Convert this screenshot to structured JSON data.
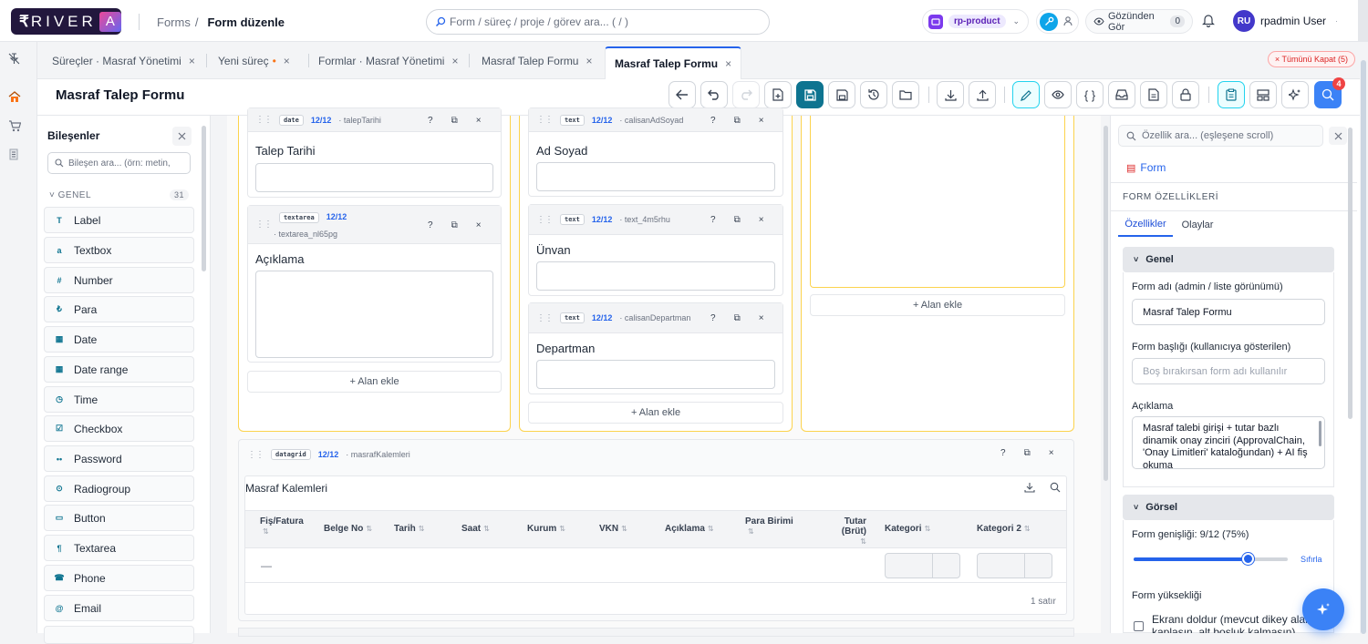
{
  "app": {
    "logo_text": "RIVER",
    "logo_letter": "A"
  },
  "breadcrumb": {
    "parent": "Forms",
    "separator": "/",
    "current": "Form düzenle"
  },
  "global_search": {
    "placeholder": "Form / süreç / proje / görev ara... ( / )"
  },
  "project": {
    "name": "rp-product"
  },
  "see_as": {
    "label": "Gözünden Gör",
    "count": "0"
  },
  "user": {
    "initials": "RU",
    "name": "rpadmin User"
  },
  "tabs": [
    {
      "label": "Süreçler · Masraf Yönetimi"
    },
    {
      "label": "Yeni süreç",
      "dot": "•"
    },
    {
      "label": "Formlar · Masraf Yönetimi"
    },
    {
      "label": "Masraf Talep Formu"
    },
    {
      "label": "Masraf Talep Formu",
      "active": true
    }
  ],
  "close_all": "× Tümünü Kapat (5)",
  "page_title": "Masraf Talep Formu",
  "toolbar": {
    "notification_count": "4"
  },
  "left_panel": {
    "title": "Bileşenler",
    "search_placeholder": "Bileşen ara... (örn: metin,",
    "group": {
      "label": "˅  GENEL",
      "count": "31"
    },
    "components": [
      {
        "icon": "T",
        "label": "Label"
      },
      {
        "icon": "a",
        "label": "Textbox"
      },
      {
        "icon": "#",
        "label": "Number"
      },
      {
        "icon": "₺",
        "label": "Para"
      },
      {
        "icon": "▦",
        "label": "Date"
      },
      {
        "icon": "▦",
        "label": "Date range"
      },
      {
        "icon": "◷",
        "label": "Time"
      },
      {
        "icon": "☑",
        "label": "Checkbox"
      },
      {
        "icon": "••",
        "label": "Password"
      },
      {
        "icon": "⊙",
        "label": "Radiogroup"
      },
      {
        "icon": "▭",
        "label": "Button"
      },
      {
        "icon": "¶",
        "label": "Textarea"
      },
      {
        "icon": "☎",
        "label": "Phone"
      },
      {
        "icon": "@",
        "label": "Email"
      }
    ]
  },
  "canvas": {
    "col1": {
      "f1": {
        "type": "date",
        "width": "12/12",
        "key": "· talepTarihi",
        "label": "Talep Tarihi"
      },
      "f2": {
        "type": "textarea",
        "width": "12/12",
        "key": "· textarea_nl65pg",
        "label": "Açıklama"
      },
      "add": "+ Alan ekle"
    },
    "col2": {
      "f1": {
        "type": "text",
        "width": "12/12",
        "key": "· calisanAdSoyad",
        "label": "Ad Soyad"
      },
      "f2": {
        "type": "text",
        "width": "12/12",
        "key": "· text_4m5rhu",
        "label": "Ünvan"
      },
      "f3": {
        "type": "text",
        "width": "12/12",
        "key": "· calisanDepartman",
        "label": "Departman"
      },
      "add": "+ Alan ekle"
    },
    "col3": {
      "add": "+ Alan ekle"
    },
    "help": "?",
    "datagrid": {
      "type": "datagrid",
      "width": "12/12",
      "key": "· masrafKalemleri",
      "title": "Masraf Kalemleri",
      "columns": [
        "Fiş/Fatura",
        "Belge No",
        "Tarih",
        "Saat",
        "Kurum",
        "VKN",
        "Açıklama",
        "Para Birimi",
        "Tutar (Brüt)",
        "Kategori",
        "Kategori 2"
      ],
      "empty_cell": "—",
      "row_count": "1 satır"
    }
  },
  "right_panel": {
    "search_placeholder": "Özellik ara... (eşleşene scroll)",
    "form_link": "Form",
    "section_title": "FORM ÖZELLİKLERİ",
    "tabs": [
      "Özellikler",
      "Olaylar"
    ],
    "genel": {
      "title": "Genel",
      "form_name_label": "Form adı (admin / liste görünümü)",
      "form_name_value": "Masraf Talep Formu",
      "form_title_label": "Form başlığı (kullanıcıya gösterilen)",
      "form_title_placeholder": "Boş bırakırsan form adı kullanılır",
      "desc_label": "Açıklama",
      "desc_value": "Masraf talebi girişi + tutar bazlı dinamik onay zinciri (ApprovalChain, 'Onay Limitleri' kataloğundan) + AI fiş okuma"
    },
    "gorsel": {
      "title": "Görsel",
      "width_label": "Form genişliği: 9/12 (75%)",
      "width_fraction": 0.75,
      "reset": "Sıfırla",
      "height_label": "Form yüksekliği",
      "fill_label": "Ekranı doldur (mevcut dikey alanı kaplasın, alt boşluk kalmasın)"
    }
  }
}
